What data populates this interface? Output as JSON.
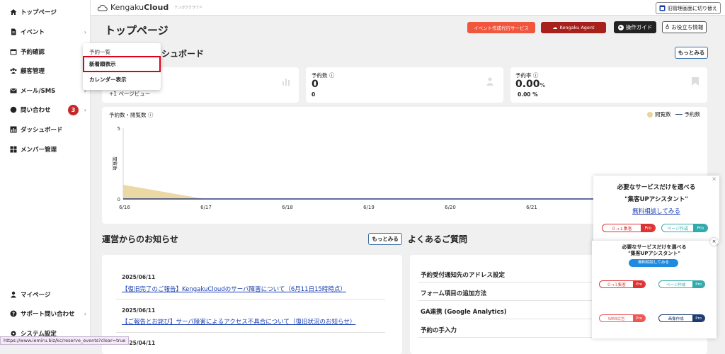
{
  "sidebar": {
    "items": [
      {
        "label": "トップページ",
        "icon": "home-icon"
      },
      {
        "label": "イベント",
        "icon": "document-icon"
      },
      {
        "label": "予約確認",
        "icon": "calendar-icon"
      },
      {
        "label": "顧客管理",
        "icon": "users-icon"
      },
      {
        "label": "メール/SMS",
        "icon": "mail-icon"
      },
      {
        "label": "問い合わせ",
        "icon": "chat-icon",
        "badge": "3"
      },
      {
        "label": "ダッシュボード",
        "icon": "chart-icon"
      },
      {
        "label": "メンバー管理",
        "icon": "grid-icon"
      }
    ],
    "bottom_items": [
      {
        "label": "マイページ",
        "icon": "person-icon"
      },
      {
        "label": "サポート問い合わせ",
        "icon": "help-icon"
      },
      {
        "label": "システム設定",
        "icon": "gear-icon"
      }
    ],
    "chevron": "›"
  },
  "header": {
    "brand_prefix": "Kengaku",
    "brand_bold": "Cloud",
    "brand_sub": "ケンガククラウド",
    "old_admin_label": "旧管理画面に切り替え"
  },
  "page": {
    "title": "トップページ",
    "buttons": {
      "event_agency": "イベント作成代行サービス",
      "agent": "Kengaku Agent",
      "guide": "操作ガイド",
      "tips": "お役立ち情報"
    },
    "dashboard_title_partial": "シュボード",
    "more_label": "もっとみる"
  },
  "dropdown": {
    "header": "予約一覧",
    "items": [
      "新着順表示",
      "カレンダー表示"
    ]
  },
  "stats": [
    {
      "label": "",
      "value": "",
      "sub": "+1 ページビュー"
    },
    {
      "label": "予約数",
      "value": "0",
      "sub": "0"
    },
    {
      "label": "予約率",
      "value": "0.00",
      "unit": "%",
      "sub": "0.00 %"
    }
  ],
  "chart_data": {
    "type": "area",
    "title": "予約数・閲覧数",
    "ylabel": "閲覧数",
    "categories": [
      "6/16",
      "6/17",
      "6/18",
      "6/19",
      "6/20",
      "6/21"
    ],
    "series": [
      {
        "name": "閲覧数",
        "values": [
          1,
          0,
          0,
          0,
          0,
          0
        ],
        "color": "#e8d59a"
      },
      {
        "name": "予約数",
        "values": [
          0,
          0,
          0,
          0,
          0,
          0
        ],
        "color": "#2c3e7a"
      }
    ],
    "ylim": [
      0,
      5
    ],
    "yticks": [
      "0",
      "5"
    ],
    "legend": "top-right"
  },
  "news": {
    "title": "運営からのお知らせ",
    "items": [
      {
        "date": "2025/06/11",
        "text": "【復旧完了のご報告】KengakuCloudのサーバ障害について（6月11日15時時点）"
      },
      {
        "date": "2025/06/11",
        "text": "【ご報告とお詫び】サーバ障害によるアクセス不具合について（復旧状況のお知らせ）"
      },
      {
        "date": "2025/04/11",
        "text": ""
      }
    ]
  },
  "faq": {
    "title": "よくあるご質問",
    "items": [
      "予約受付通知先のアドレス設定",
      "フォーム項目の追加方法",
      "GA連携 (Google Analytics)",
      "予約の手入力"
    ]
  },
  "popup1": {
    "line1": "必要なサービスだけを選べる",
    "line2": "\"集客UPアシスタント\"",
    "link": "無料相談してみる",
    "badge_a": "０→１集客",
    "badge_b": "ページ作成",
    "pro": "Pro"
  },
  "popup2": {
    "line1": "必要なサービスだけを選べる",
    "line2": "\"集客UPアシスタント\"",
    "button": "無料相談してみる",
    "badge_a": "０→１集客",
    "badge_b": "ページ作成",
    "badge_c": "WEB広告",
    "badge_d": "画像作成",
    "pro": "Pro"
  },
  "status_url": "https://www.iemiru.biz/kc/reserve_events?clear=true",
  "colors": {
    "accent_red": "#e0001a",
    "chart_fill": "#e8d59a",
    "chart_line": "#2c3e7a",
    "link_blue": "#1a3fb0"
  }
}
